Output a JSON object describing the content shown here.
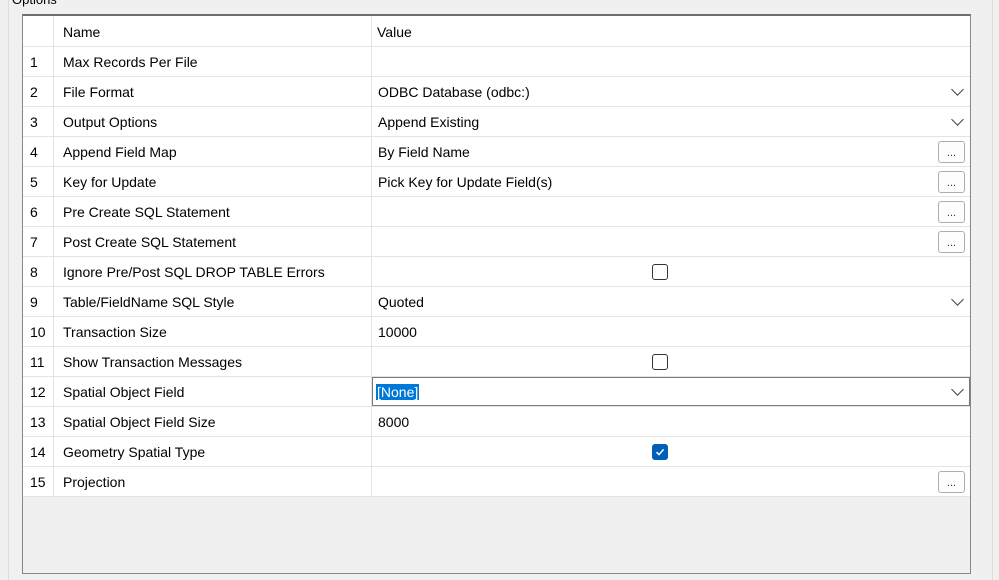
{
  "group": {
    "label": "Options"
  },
  "grid": {
    "header": {
      "num": "",
      "name": "Name",
      "value": "Value"
    },
    "rows": [
      {
        "num": "1",
        "name": "Max Records Per File",
        "value": "",
        "editor": "text"
      },
      {
        "num": "2",
        "name": "File Format",
        "value": "ODBC Database (odbc:)",
        "editor": "dropdown"
      },
      {
        "num": "3",
        "name": "Output Options",
        "value": "Append Existing",
        "editor": "dropdown"
      },
      {
        "num": "4",
        "name": "Append Field Map",
        "value": "By Field Name",
        "editor": "ellipsis"
      },
      {
        "num": "5",
        "name": "Key for Update",
        "value": "Pick Key for Update Field(s)",
        "editor": "ellipsis"
      },
      {
        "num": "6",
        "name": "Pre Create SQL Statement",
        "value": "",
        "editor": "ellipsis"
      },
      {
        "num": "7",
        "name": "Post Create SQL Statement",
        "value": "",
        "editor": "ellipsis"
      },
      {
        "num": "8",
        "name": "Ignore Pre/Post SQL DROP TABLE Errors",
        "value": "",
        "editor": "checkbox",
        "checked": false
      },
      {
        "num": "9",
        "name": "Table/FieldName SQL Style",
        "value": "Quoted",
        "editor": "dropdown"
      },
      {
        "num": "10",
        "name": "Transaction Size",
        "value": "10000",
        "editor": "text"
      },
      {
        "num": "11",
        "name": "Show Transaction Messages",
        "value": "",
        "editor": "checkbox",
        "checked": false
      },
      {
        "num": "12",
        "name": "Spatial Object Field",
        "value": "[None]",
        "editor": "dropdown",
        "selected": true
      },
      {
        "num": "13",
        "name": "Spatial Object Field Size",
        "value": "8000",
        "editor": "text"
      },
      {
        "num": "14",
        "name": "Geometry Spatial Type",
        "value": "",
        "editor": "checkbox",
        "checked": true
      },
      {
        "num": "15",
        "name": "Projection",
        "value": "",
        "editor": "ellipsis"
      }
    ],
    "ellipsis_label": "...",
    "icons": {
      "dropdown": "chevron-down-icon",
      "check": "checkmark-icon"
    }
  },
  "colors": {
    "accent": "#0078d7",
    "checkbox_checked": "#005fb8"
  }
}
